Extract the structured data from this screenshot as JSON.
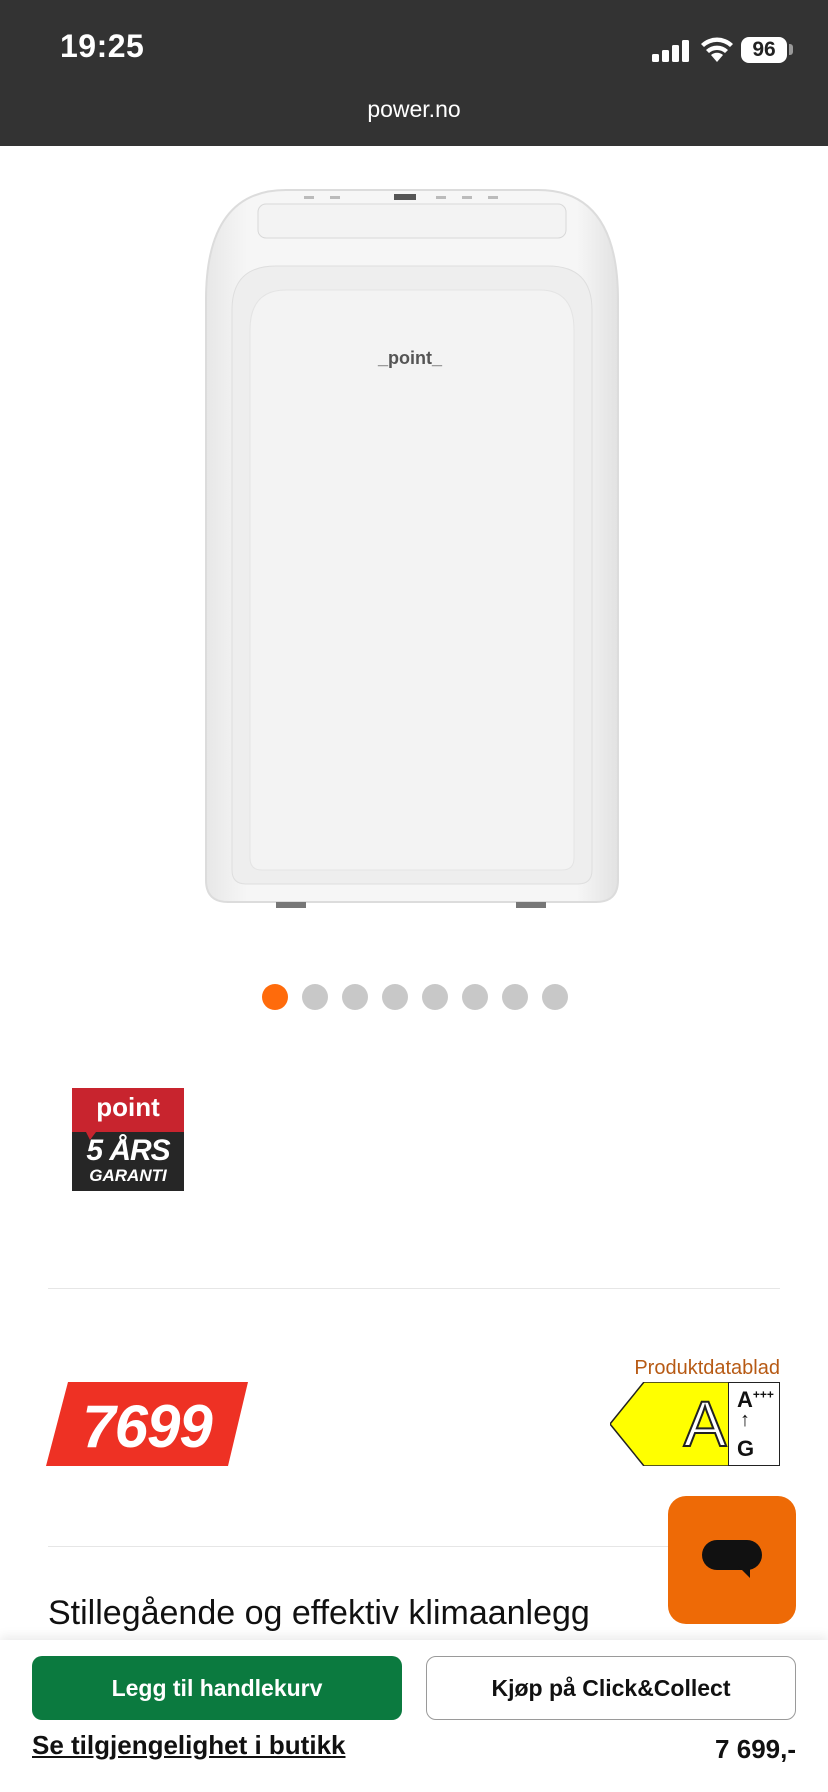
{
  "status_bar": {
    "time": "19:25",
    "battery": "96",
    "url": "power.no"
  },
  "gallery": {
    "total": 8,
    "active_index": 0
  },
  "warranty_badge": {
    "brand": "point",
    "line1": "5 ÅRS",
    "line2": "GARANTI"
  },
  "price": {
    "value": "7699"
  },
  "energy_label": {
    "link": "Produktdatablad",
    "class": "A",
    "scale_top": "A",
    "scale_top_sup": "+++",
    "scale_arrow": "↑",
    "scale_bottom": "G"
  },
  "product": {
    "title": "Stillegående og effektiv klimaanlegg",
    "image_brand": "point"
  },
  "actions": {
    "add_to_cart": "Legg til handlekurv",
    "click_collect": "Kjøp på Click&Collect",
    "availability": "Se tilgjengelighet i butikk",
    "price_display": "7 699,-"
  },
  "colors": {
    "accent": "#ff6b0b",
    "price_red": "#ee3124",
    "cart_green": "#0b7a3f",
    "chat_orange": "#ee6a06"
  }
}
